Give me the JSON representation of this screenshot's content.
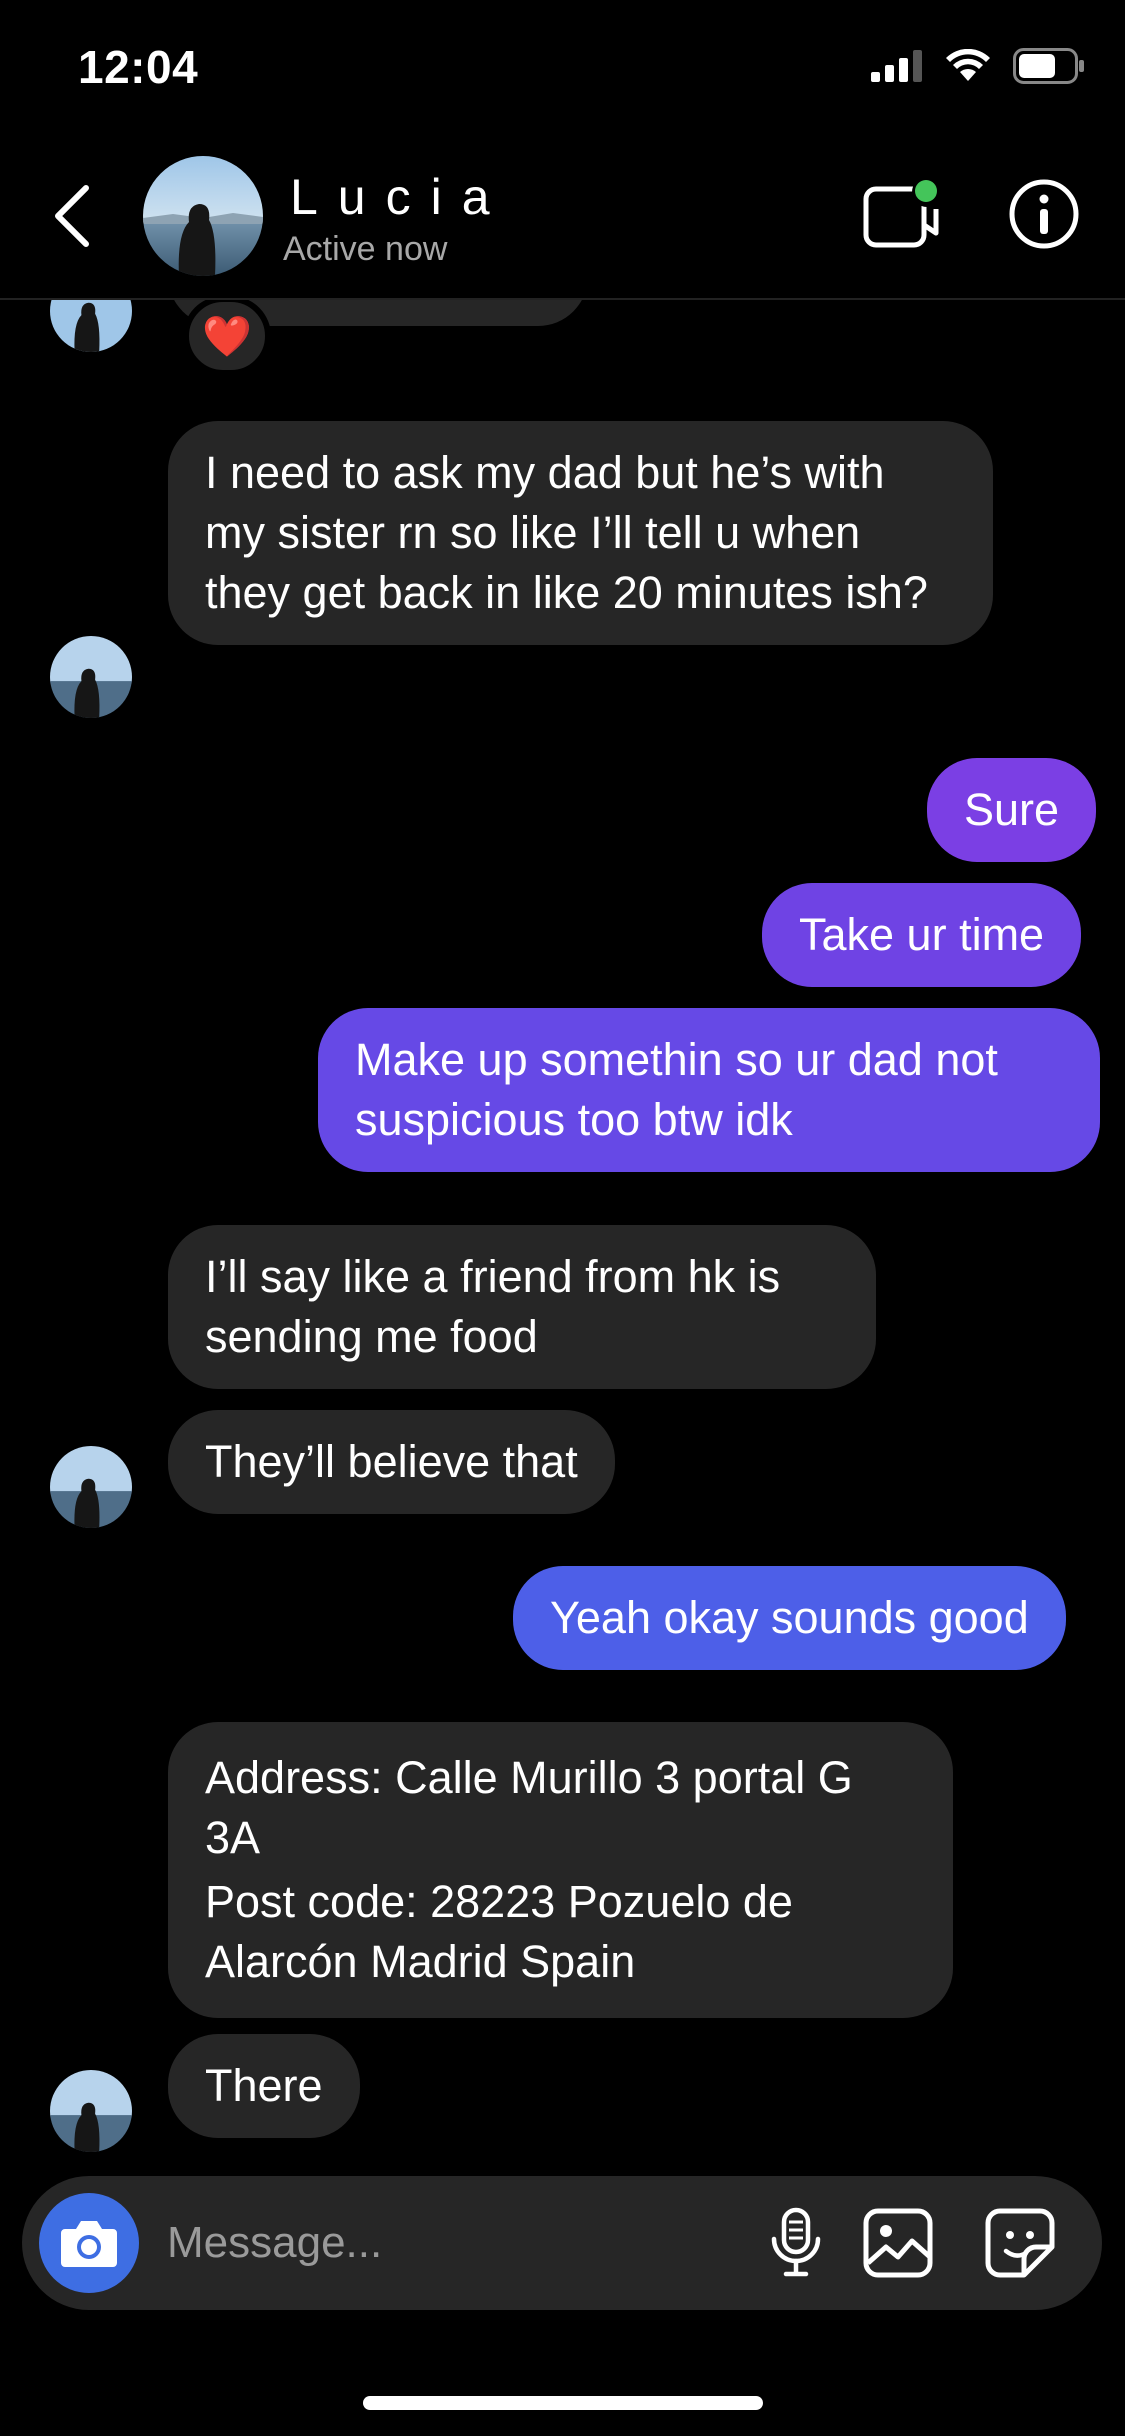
{
  "status_bar": {
    "time": "12:04"
  },
  "header": {
    "contact_name": "Lucia",
    "status": "Active now"
  },
  "messages": {
    "reaction": "❤️",
    "m1": "I need to ask my dad but he’s with my sister rn so like I’ll tell u when they get back in like 20 minutes ish?",
    "m2": "Sure",
    "m3": "Take ur time",
    "m4": "Make up somethin so ur dad not suspicious too btw idk",
    "m5": "I’ll say like a friend from hk is sending me food",
    "m6": "They’ll believe that",
    "m7": "Yeah okay sounds good",
    "m8_line1": "Address: Calle Murillo 3 portal G 3A",
    "m8_line2": "Post code: 28223 Pozuelo de Alarcón Madrid Spain",
    "m9": "There"
  },
  "input": {
    "placeholder": "Message..."
  },
  "colors": {
    "incoming_bubble": "#262626",
    "outgoing_purple": "#7b3fe4",
    "outgoing_blue": "#4d5fe8",
    "camera_button": "#3e6ee3",
    "active_dot": "#44c55a"
  }
}
